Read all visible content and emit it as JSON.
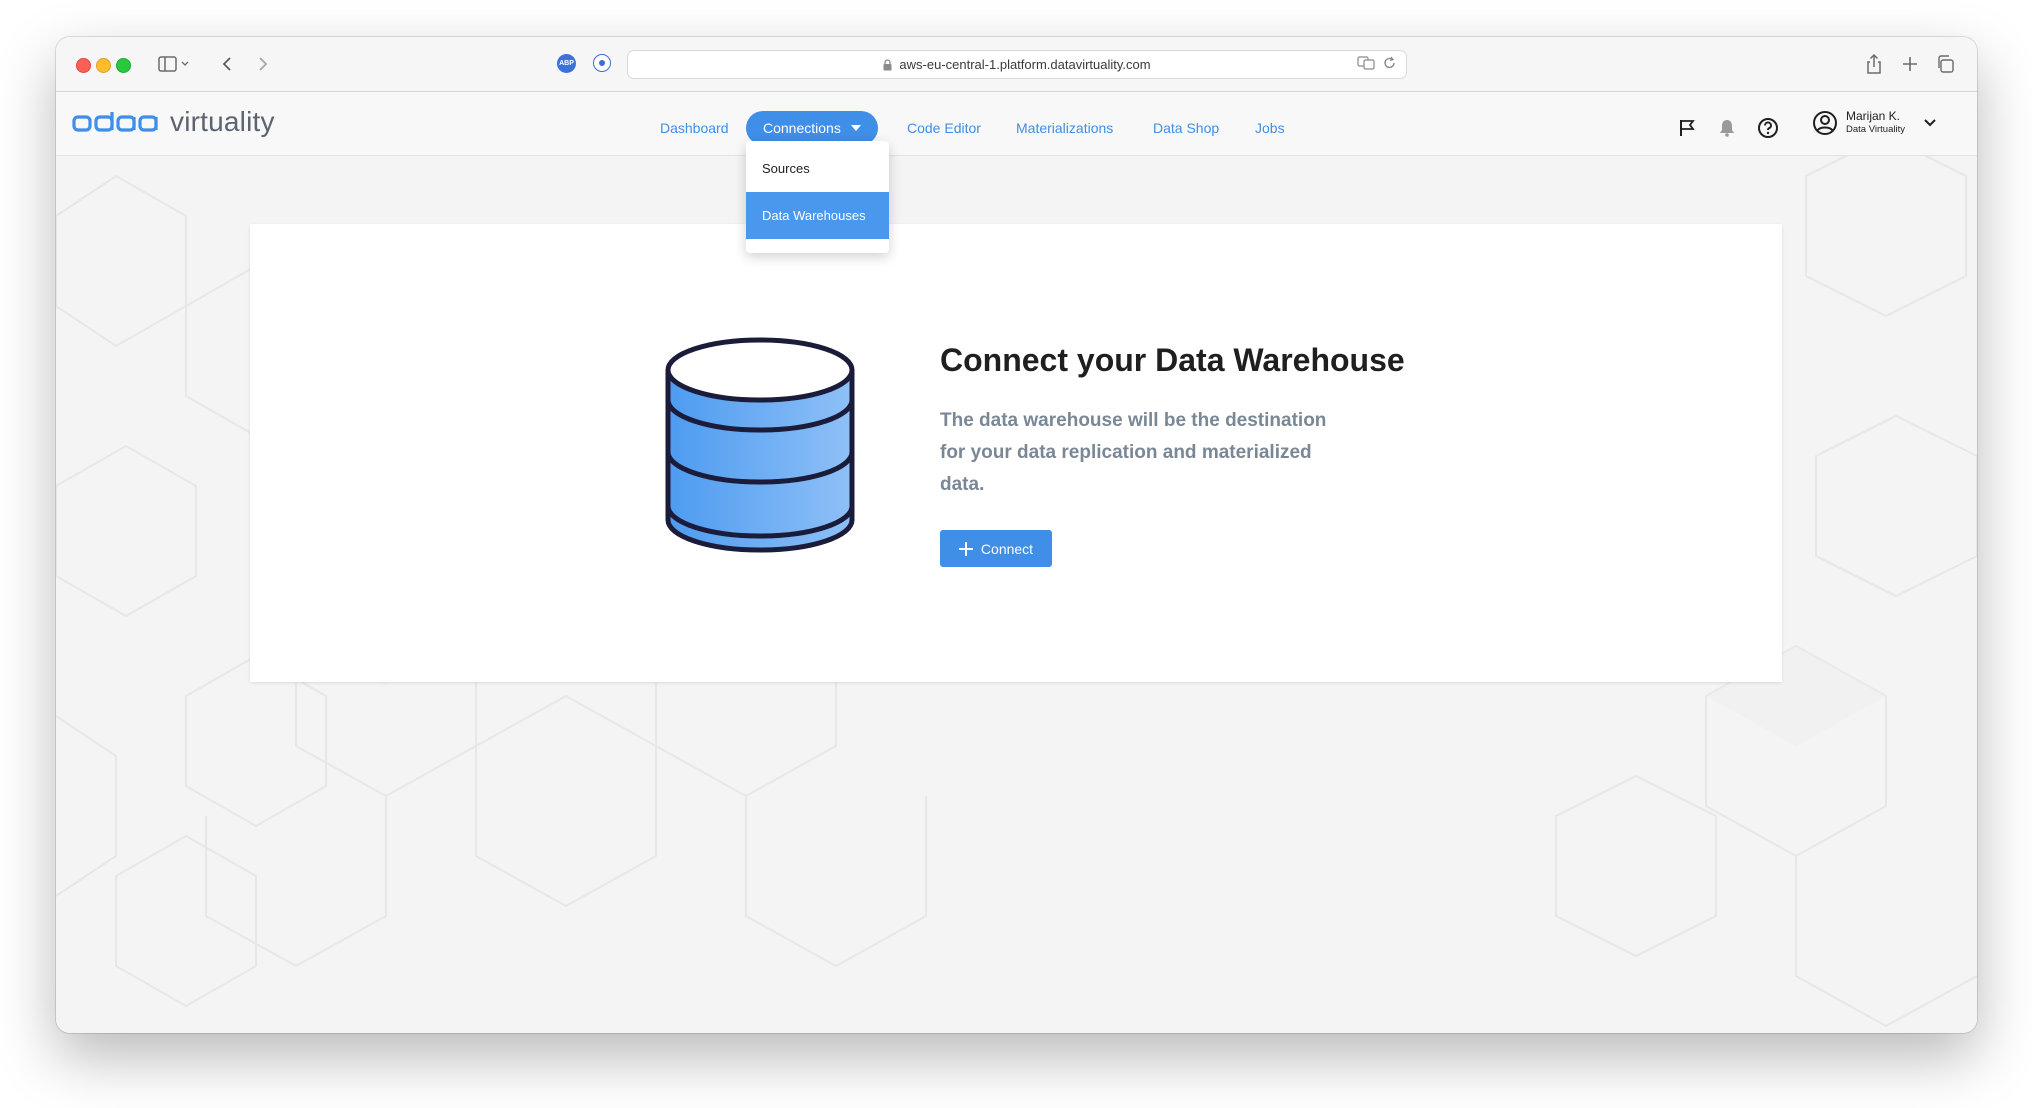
{
  "browser": {
    "url": "aws-eu-central-1.platform.datavirtuality.com",
    "extension_abp_label": "ABP"
  },
  "app": {
    "logo_text": "virtuality",
    "nav": [
      {
        "label": "Dashboard"
      },
      {
        "label": "Connections"
      },
      {
        "label": "Code Editor"
      },
      {
        "label": "Materializations"
      },
      {
        "label": "Data Shop"
      },
      {
        "label": "Jobs"
      }
    ],
    "user": {
      "name": "Marijan K.",
      "org": "Data Virtuality"
    }
  },
  "dropdown": {
    "items": [
      {
        "label": "Sources"
      },
      {
        "label": "Data Warehouses"
      }
    ],
    "active_index": 1
  },
  "empty_state": {
    "title": "Connect your Data Warehouse",
    "description": "The data warehouse will be the destination for your data replication and materialized data.",
    "button_label": "Connect"
  },
  "colors": {
    "accent": "#3f8ee8",
    "db_fill": "#5aa3f0",
    "db_stroke": "#1b1b3a"
  },
  "icons": {
    "flag": "flag-icon",
    "bell": "bell-icon",
    "help": "help-icon",
    "user": "user-circle-icon",
    "chevron": "chevron-down-icon"
  }
}
